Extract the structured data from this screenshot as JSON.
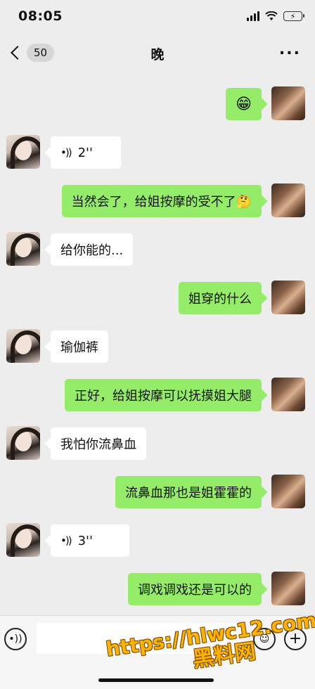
{
  "status_bar": {
    "time": "08:05"
  },
  "nav": {
    "unread_count": "50",
    "title": "晚",
    "more_label": "..."
  },
  "messages": [
    {
      "side": "me",
      "type": "emoji",
      "content": "😁"
    },
    {
      "side": "them",
      "type": "voice",
      "content": "2''"
    },
    {
      "side": "me",
      "type": "text",
      "content": "当然会了，给姐按摩的受不了🤔"
    },
    {
      "side": "them",
      "type": "text",
      "content": "给你能的..."
    },
    {
      "side": "me",
      "type": "text",
      "content": "姐穿的什么"
    },
    {
      "side": "them",
      "type": "text",
      "content": "瑜伽裤"
    },
    {
      "side": "me",
      "type": "text",
      "content": "正好，给姐按摩可以抚摸姐大腿"
    },
    {
      "side": "them",
      "type": "text",
      "content": "我怕你流鼻血"
    },
    {
      "side": "me",
      "type": "text",
      "content": "流鼻血那也是姐霍霍的"
    },
    {
      "side": "them",
      "type": "voice",
      "content": "3''"
    },
    {
      "side": "me",
      "type": "text",
      "content": "调戏调戏还是可以的"
    }
  ],
  "watermark": {
    "line1": "https://hlwc12.com",
    "line2": "黑料网"
  },
  "colors": {
    "background": "#ededed",
    "my_bubble": "#95ec69",
    "their_bubble": "#ffffff",
    "watermark": "#ffb300"
  }
}
